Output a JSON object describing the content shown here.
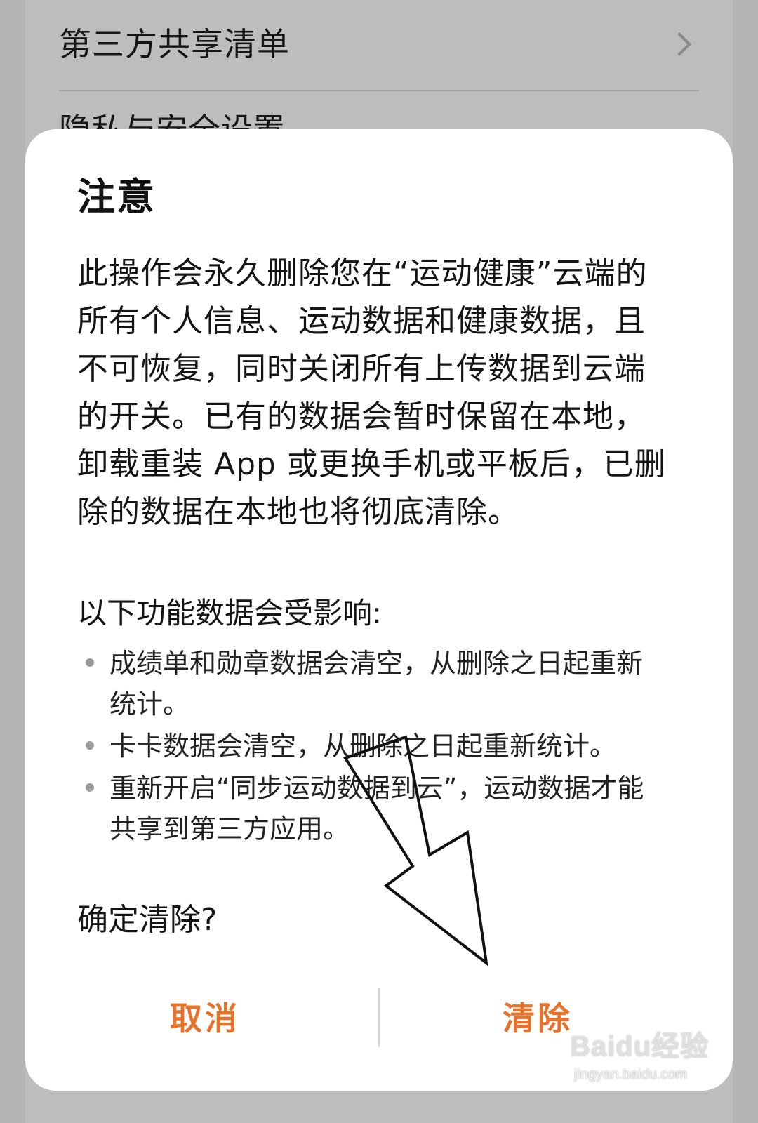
{
  "background": {
    "list_item_label": "第三方共享清单",
    "partial_item_label": "隐私与安全设置"
  },
  "dialog": {
    "title": "注意",
    "body": "此操作会永久删除您在“运动健康”云端的所有个人信息、运动数据和健康数据，且不可恢复，同时关闭所有上传数据到云端的开关。已有的数据会暂时保留在本地，卸载重装 App 或更换手机或平板后，已删除的数据在本地也将彻底清除。",
    "affected_title": "以下功能数据会受影响:",
    "bullets": [
      "成绩单和勋章数据会清空，从删除之日起重新统计。",
      "卡卡数据会清空，从删除之日起重新统计。",
      "重新开启“同步运动数据到云”，运动数据才能共享到第三方应用。"
    ],
    "confirm_question": "确定清除?",
    "cancel_label": "取消",
    "clear_label": "清除"
  },
  "colors": {
    "accent": "#e8722a",
    "dialog_bg": "#ffffff",
    "scrim": "#b5b5b5"
  },
  "watermark": {
    "logo": "Baidu经验",
    "url": "jingyan.baidu.com"
  },
  "icons": {
    "row_chevron": "chevron-right-icon",
    "annotation": "arrow-annotation-icon"
  }
}
